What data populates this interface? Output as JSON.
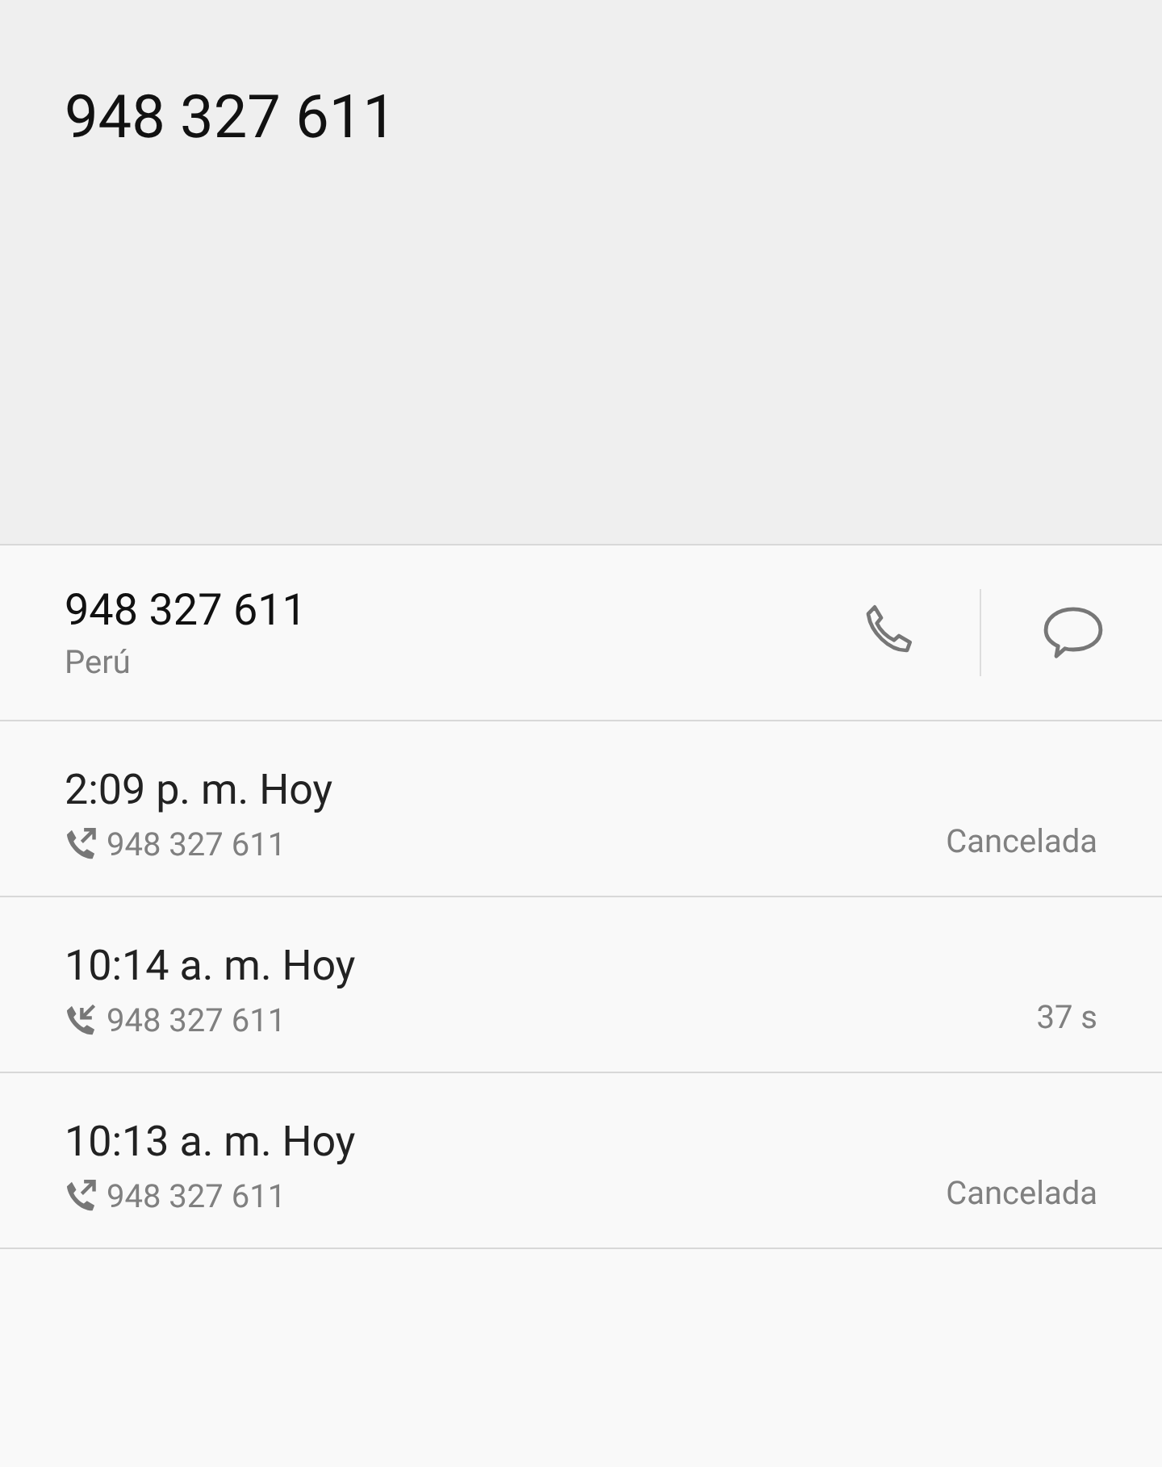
{
  "header": {
    "title": "948 327 611"
  },
  "contact": {
    "number": "948 327 611",
    "country": "Perú"
  },
  "calls": [
    {
      "time": "2:09 p. m. Hoy",
      "kind": "outgoing",
      "number": "948 327 611",
      "result": "Cancelada"
    },
    {
      "time": "10:14 a. m. Hoy",
      "kind": "incoming",
      "number": "948 327 611",
      "result": "37 s"
    },
    {
      "time": "10:13 a. m. Hoy",
      "kind": "outgoing",
      "number": "948 327 611",
      "result": "Cancelada"
    }
  ]
}
